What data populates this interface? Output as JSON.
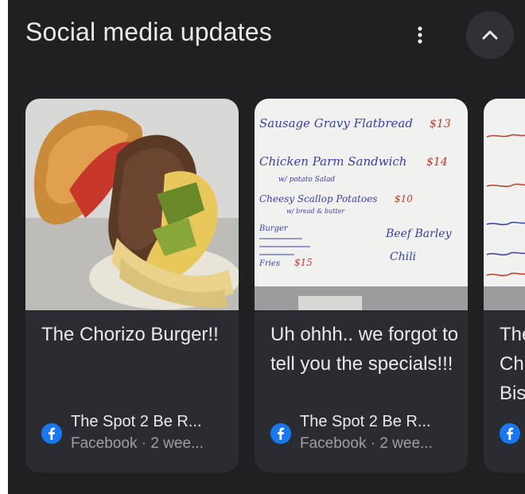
{
  "section": {
    "title": "Social media updates",
    "more_icon": "more-vert-icon",
    "collapse_icon": "chevron-up-icon"
  },
  "cards": [
    {
      "title": "The Chorizo Burger!!",
      "source_name": "The Spot 2 Be R...",
      "source_meta": "Facebook · 2 wee...",
      "image": "burger-photo",
      "icon": "facebook-icon"
    },
    {
      "title": "Uh ohhh.. we forgot to tell you the specials!!!",
      "source_name": "The Spot 2 Be R...",
      "source_meta": "Facebook · 2 wee...",
      "image": "whiteboard-specials-photo",
      "icon": "facebook-icon",
      "whiteboard": {
        "line1": "Sausage Gravy Flatbread",
        "price1": "$13",
        "line2": "Chicken Parm Sandwich",
        "price2": "$14",
        "line2b": "w/ potato Salad",
        "line3": "Cheesy Scallop Potatoes",
        "price3": "$10",
        "line3b": "w/ bread & butter",
        "line4": "Beef Barley",
        "line4b": "Chili",
        "line5": "Burger",
        "line5b": "Fries",
        "price5": "$15"
      }
    },
    {
      "title": "The Ch Bis",
      "title_lines": [
        "The",
        "Ch",
        "Bis"
      ],
      "image": "whiteboard-partial-photo",
      "icon": "facebook-icon"
    }
  ],
  "colors": {
    "background": "#1f2022",
    "card": "#2b2c2f",
    "text_primary": "#e8eaed",
    "text_secondary": "#9aa0a6",
    "facebook_blue": "#1877f2"
  }
}
